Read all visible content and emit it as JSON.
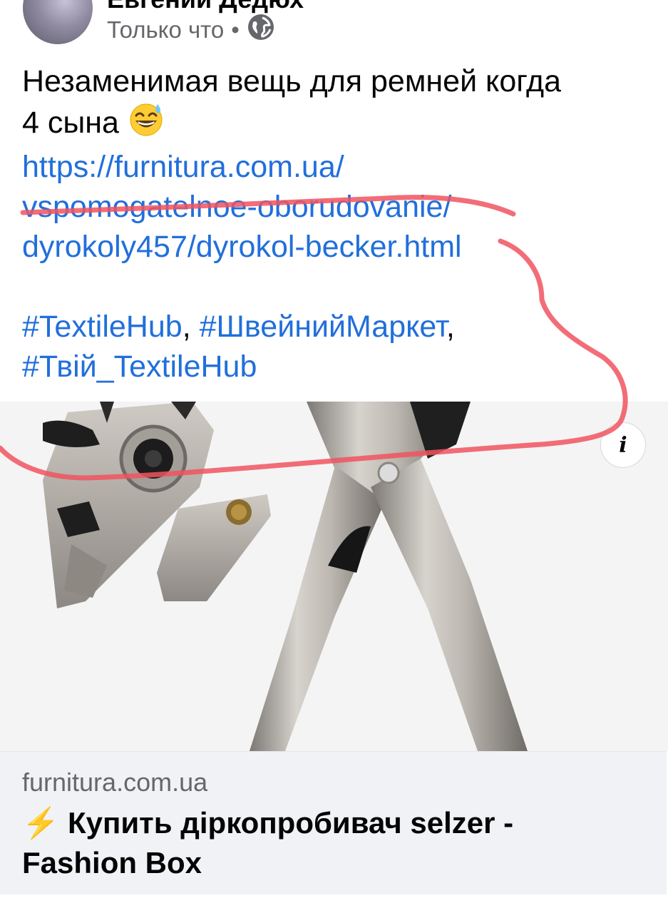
{
  "post": {
    "author": "Евгений Дедюх",
    "time": "Только что",
    "separator": "•",
    "audience_icon": "globe-icon",
    "text_line1": "Незаменимая вещь для ремней когда",
    "text_line2": "4 сына",
    "emoji": "😅",
    "url_line1": "https://furnitura.com.ua/",
    "url_line2": "vspomogatelnoe-oborudovanie/",
    "url_line3": "dyrokoly457/dyrokol-becker.html",
    "hashtags": [
      "#TextileHub",
      "#ШвейнийМаркет",
      "#Твій_TextileHub"
    ],
    "hashtag_separator": ","
  },
  "preview": {
    "image_description_icon": "hole-punch-pliers-image",
    "info_icon": "i",
    "domain": "furnitura.com.ua",
    "title_icon": "⚡",
    "title": "Купить діркопробивач selzer - Fashion Box"
  },
  "colors": {
    "link": "#216fdb",
    "meta": "#65676b",
    "annotation": "#f0535f",
    "preview_bg": "#f0f2f5"
  }
}
